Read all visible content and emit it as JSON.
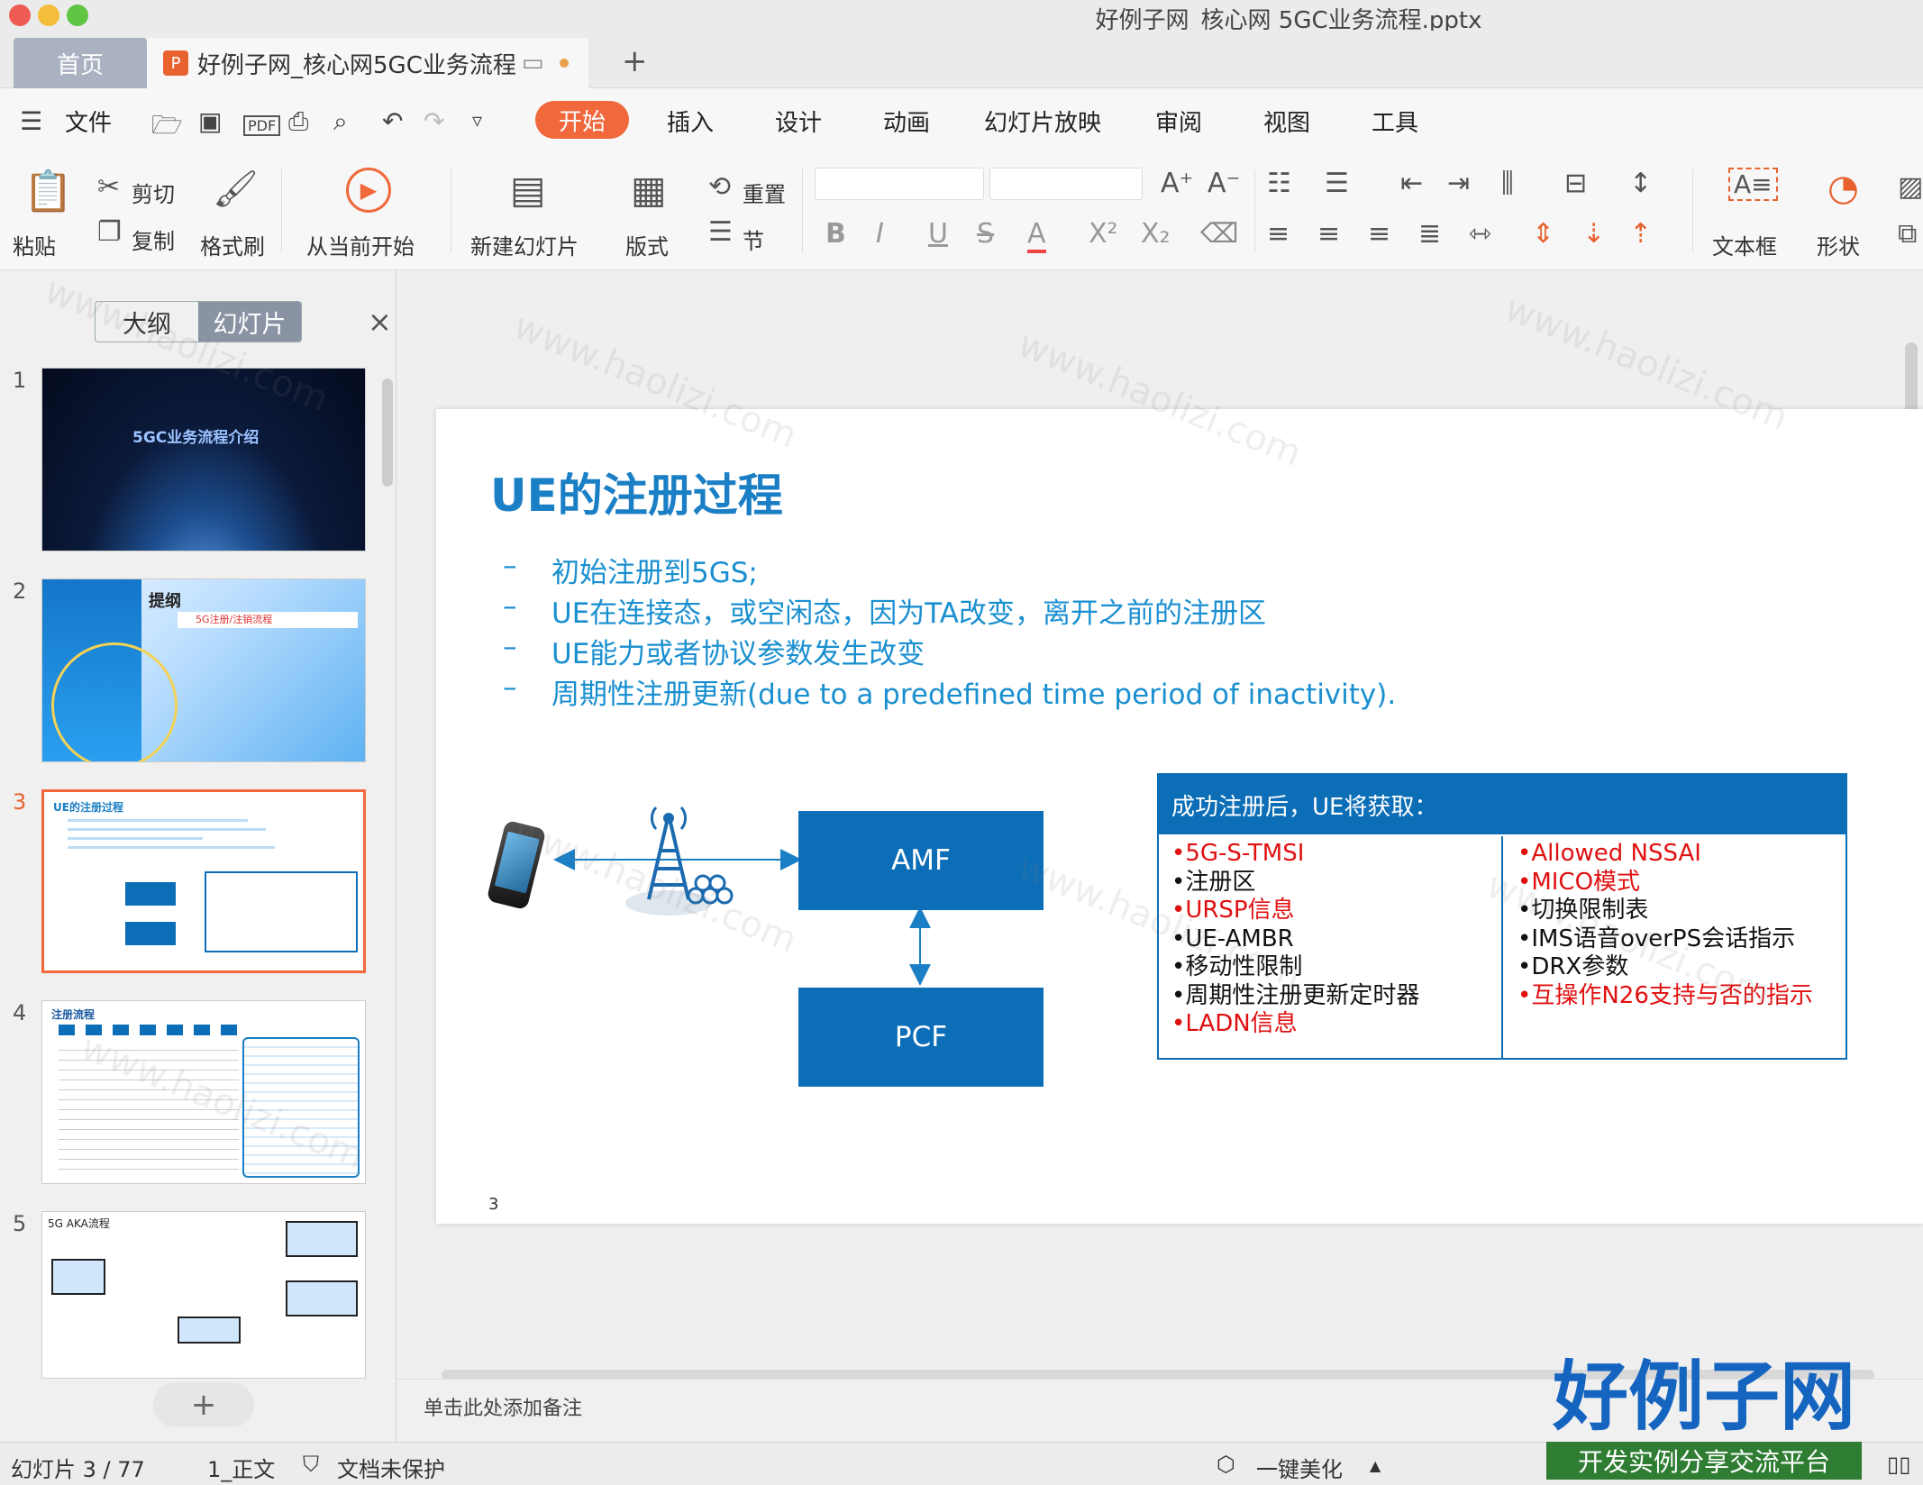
{
  "window": {
    "title": "好例子网_核心网 5GC业务流程.pptx"
  },
  "tabs": {
    "home": "首页",
    "doc": "好例子网_核心网5GC业务流程"
  },
  "menu": {
    "file": "文件",
    "items": [
      "开始",
      "插入",
      "设计",
      "动画",
      "幻灯片放映",
      "审阅",
      "视图",
      "工具"
    ]
  },
  "ribbon": {
    "paste": "粘贴",
    "cut": "剪切",
    "copy": "复制",
    "format_painter": "格式刷",
    "play_from_current": "从当前开始",
    "new_slide": "新建幻灯片",
    "layout": "版式",
    "reset": "重置",
    "section": "节",
    "textbox": "文本框",
    "shape": "形状"
  },
  "panel": {
    "outline_tab": "大纲",
    "slides_tab": "幻灯片",
    "close": "×",
    "add": "+"
  },
  "thumbs": {
    "s1_title": "5GC业务流程介绍",
    "s2_title": "提纲",
    "s2_item": "5G注册/注销流程",
    "s3_title": "UE的注册过程",
    "s4_title": "注册流程",
    "s5_title": "5G AKA流程"
  },
  "slide": {
    "title": "UE的注册过程",
    "bullets": [
      "初始注册到5GS;",
      "UE在连接态，或空闲态，因为TA改变，离开之前的注册区",
      "UE能力或者协议参数发生改变",
      "周期性注册更新(due to a predefined time period of inactivity)."
    ],
    "amf": "AMF",
    "pcf": "PCF",
    "info_header": "成功注册后，UE将获取：",
    "left_items": [
      {
        "text": "•5G-S-TMSI",
        "red": true
      },
      {
        "text": "•注册区",
        "red": false
      },
      {
        "text": "•URSP信息",
        "red": true
      },
      {
        "text": "•UE-AMBR",
        "red": false
      },
      {
        "text": "•移动性限制",
        "red": false
      },
      {
        "text": "•周期性注册更新定时器",
        "red": false
      },
      {
        "text": "•LADN信息",
        "red": true
      }
    ],
    "right_items": [
      {
        "text": "•Allowed NSSAI",
        "red": true
      },
      {
        "text": "•MICO模式",
        "red": true
      },
      {
        "text": "•切换限制表",
        "red": false
      },
      {
        "text": "•IMS语音overPS会话指示",
        "red": false
      },
      {
        "text": "•DRX参数",
        "red": false
      },
      {
        "text": "•互操作N26支持与否的指示",
        "red": true
      }
    ],
    "page_number": "3"
  },
  "notes_placeholder": "单击此处添加备注",
  "status": {
    "slide_counter": "幻灯片 3 / 77",
    "theme": "1_正文",
    "protection": "文档未保护",
    "beautify": "一键美化"
  },
  "logo": {
    "name": "好例子网",
    "slogan": "开发实例分享交流平台"
  },
  "colors": {
    "accent": "#f0683b",
    "slide_blue": "#0d6eb8",
    "title_blue": "#1a7fc5",
    "red_text": "#e01010"
  }
}
